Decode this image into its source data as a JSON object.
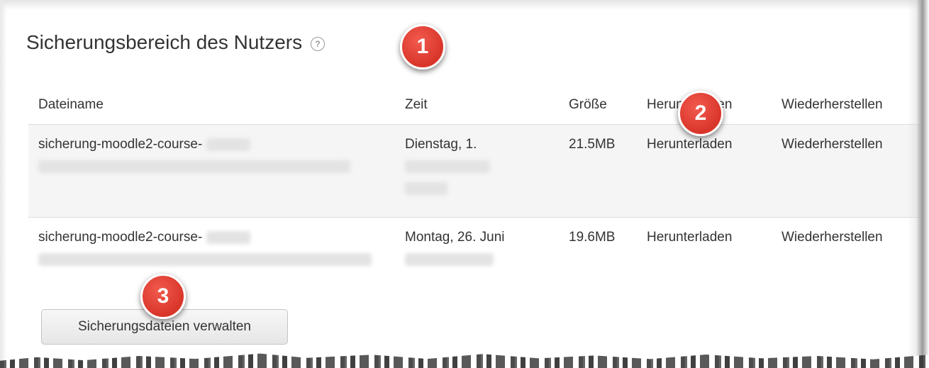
{
  "section": {
    "title": "Sicherungsbereich des Nutzers",
    "help_icon": "question-circle-icon"
  },
  "table": {
    "headers": [
      "Dateiname",
      "Zeit",
      "Größe",
      "Herunterladen",
      "Wiederherstellen"
    ],
    "rows": [
      {
        "filename": "sicherung-moodle2-course-",
        "time": "Dienstag, 1.",
        "size": "21.5MB",
        "download": "Herunterladen",
        "restore": "Wiederherstellen"
      },
      {
        "filename": "sicherung-moodle2-course-",
        "time": "Montag, 26. Juni",
        "size": "19.6MB",
        "download": "Herunterladen",
        "restore": "Wiederherstellen"
      }
    ]
  },
  "manage_button": {
    "label": "Sicherungsdateien verwalten"
  },
  "callouts": [
    "1",
    "2",
    "3"
  ],
  "colors": {
    "callout": "#d9352a",
    "row_shade": "#f5f5f5",
    "text": "#333333"
  }
}
